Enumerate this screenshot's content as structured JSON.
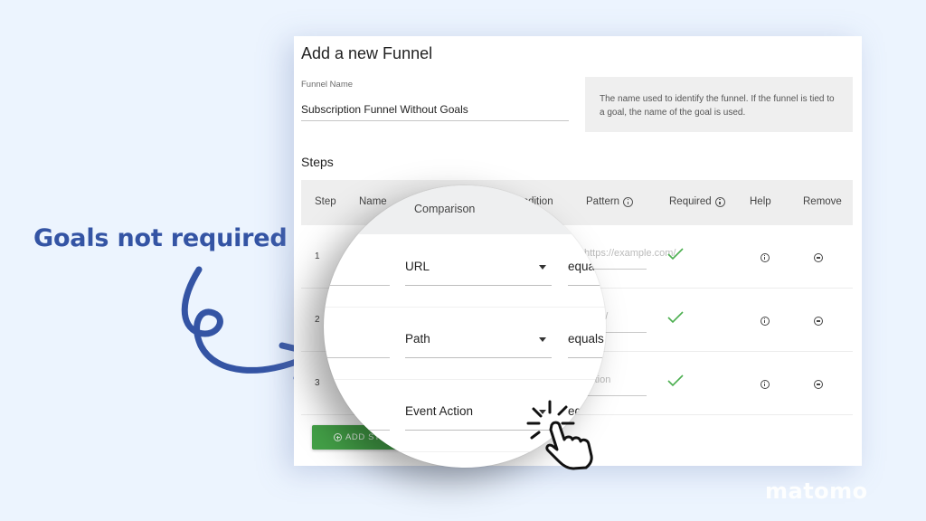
{
  "annotation": {
    "text": "Goals not required",
    "color": "#3454a4"
  },
  "card": {
    "title": "Add a new Funnel",
    "funnel_name": {
      "label": "Funnel Name",
      "value": "Subscription Funnel Without Goals"
    },
    "help_text": "The name used to identify the funnel. If the funnel is tied to a goal, the name of the goal is used.",
    "steps_title": "Steps",
    "table": {
      "headers": {
        "step": "Step",
        "name": "Name",
        "comparison": "Comparison",
        "condition": "Condition",
        "pattern": "Pattern",
        "required": "Required",
        "help": "Help",
        "remove": "Remove"
      },
      "rows": [
        {
          "step": "1",
          "comparison": "URL",
          "condition": "equals",
          "pattern_placeholder": "https://example.com/",
          "required": true
        },
        {
          "step": "2",
          "comparison": "Path",
          "condition": "equals",
          "pattern_placeholder": "/web/",
          "required": true
        },
        {
          "step": "3",
          "comparison": "Event Action",
          "condition": "equals",
          "pattern_placeholder": "action",
          "required": true
        }
      ]
    },
    "add_step_button": "ADD STEP"
  },
  "colors": {
    "background": "#ecf4fe",
    "accent_green": "#43a047",
    "check_green": "#4caf50"
  },
  "brand": "matomo"
}
